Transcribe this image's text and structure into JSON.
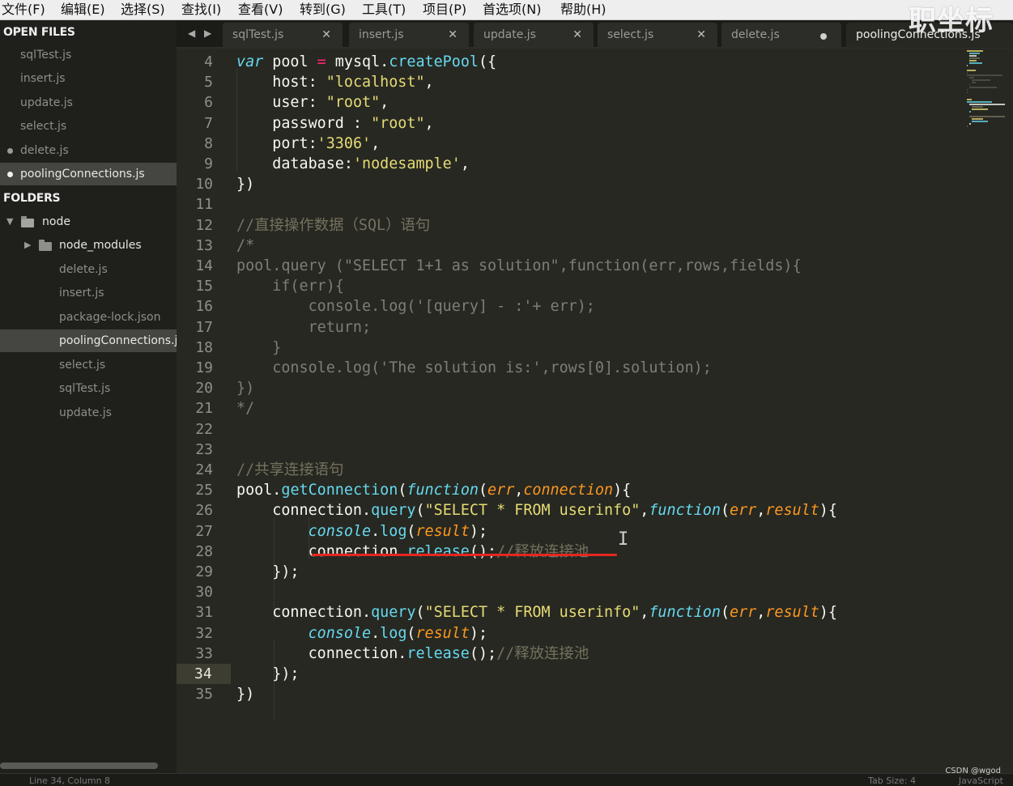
{
  "menu": [
    "文件(F)",
    "编辑(E)",
    "选择(S)",
    "查找(I)",
    "查看(V)",
    "转到(G)",
    "工具(T)",
    "项目(P)",
    "首选项(N)",
    "帮助(H)"
  ],
  "watermark": "职坐标",
  "sidebar": {
    "open_files_header": "OPEN FILES",
    "open_files": [
      {
        "name": "sqlTest.js"
      },
      {
        "name": "insert.js"
      },
      {
        "name": "update.js"
      },
      {
        "name": "select.js"
      },
      {
        "name": "delete.js"
      },
      {
        "name": "poolingConnections.js"
      }
    ],
    "folders_header": "FOLDERS",
    "root_folder": "node",
    "subfolder": "node_modules",
    "files": [
      "delete.js",
      "insert.js",
      "package-lock.json",
      "poolingConnections.js",
      "select.js",
      "sqlTest.js",
      "update.js"
    ]
  },
  "tabs": [
    {
      "name": "sqlTest.js"
    },
    {
      "name": "insert.js"
    },
    {
      "name": "update.js"
    },
    {
      "name": "select.js"
    },
    {
      "name": "delete.js"
    },
    {
      "name": "poolingConnections.js"
    }
  ],
  "editor": {
    "line_numbers": [
      4,
      5,
      6,
      7,
      8,
      9,
      10,
      11,
      12,
      13,
      14,
      15,
      16,
      17,
      18,
      19,
      20,
      21,
      22,
      23,
      24,
      25,
      26,
      27,
      28,
      29,
      30,
      31,
      32,
      33,
      34,
      35
    ],
    "current_line": 34,
    "lines": [
      "var pool = mysql.createPool({",
      "    host: \"localhost\",",
      "    user: \"root\",",
      "    password : \"root\",",
      "    port:'3306',",
      "    database:'nodesample',",
      "})",
      "",
      "//直接操作数据（SQL）语句",
      "/*",
      "pool.query (\"SELECT 1+1 as solution\",function(err,rows,fields){",
      "    if(err){",
      "        console.log('[query] - :'+ err);",
      "        return;",
      "    }",
      "    console.log('The solution is:',rows[0].solution);",
      "})",
      "*/",
      "",
      "",
      "//共享连接语句",
      "pool.getConnection(function(err,connection){",
      "    connection.query(\"SELECT * FROM userinfo\",function(err,result){",
      "        console.log(result);",
      "        connection.release();//释放连接池",
      "    });",
      "",
      "    connection.query(\"SELECT * FROM userinfo\",function(err,result){",
      "        console.log(result);",
      "        connection.release();//释放连接池",
      "    });",
      "})"
    ]
  },
  "status": {
    "position": "Line 34, Column 8",
    "tab_size": "Tab Size: 4",
    "syntax": "JavaScript"
  },
  "credit": "CSDN @wgod",
  "colors": {
    "background": "#272822",
    "keyword": "#66d9ef",
    "string": "#e6db74",
    "operator": "#f92672",
    "param": "#fd971f",
    "comment": "#75715e",
    "strike": "#e6261f"
  }
}
